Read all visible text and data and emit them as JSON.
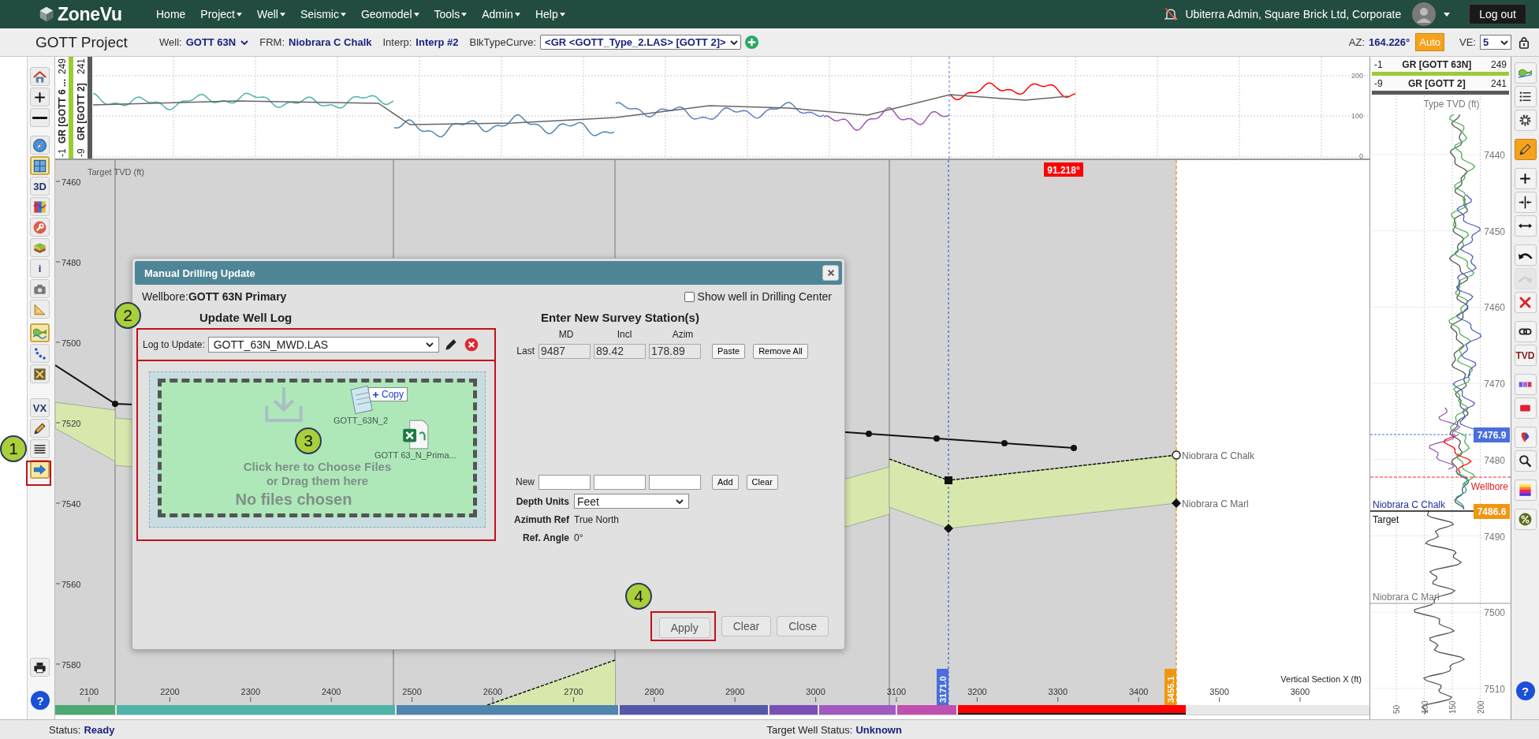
{
  "nav": {
    "logo": "ZoneVu",
    "menu": [
      {
        "label": "Home",
        "dropdown": false
      },
      {
        "label": "Project",
        "dropdown": true
      },
      {
        "label": "Well",
        "dropdown": true
      },
      {
        "label": "Seismic",
        "dropdown": true
      },
      {
        "label": "Geomodel",
        "dropdown": true
      },
      {
        "label": "Tools",
        "dropdown": true
      },
      {
        "label": "Admin",
        "dropdown": true
      },
      {
        "label": "Help",
        "dropdown": true
      }
    ],
    "user": "Ubiterra Admin, Square Brick Ltd, Corporate",
    "logout": "Log out"
  },
  "project_bar": {
    "title": "GOTT Project",
    "fields": [
      {
        "label": "Well:",
        "value": "GOTT 63N",
        "kind": "select"
      },
      {
        "label": "FRM:",
        "value": "Niobrara C Chalk",
        "kind": "text"
      },
      {
        "label": "Interp:",
        "value": "Interp #2",
        "kind": "text"
      },
      {
        "label": "BlkTypeCurve:",
        "value": "<GR <GOTT_Type_2.LAS> [GOTT 2]>",
        "kind": "select"
      }
    ],
    "az_label": "AZ:",
    "az_value": "164.226°",
    "auto": "Auto",
    "ve_label": "VE:",
    "ve_value": "5"
  },
  "left_tools": [
    {
      "items": [
        {
          "kind": "icon",
          "selected": false
        },
        {
          "kind": "icon",
          "selected": false
        },
        {
          "kind": "icon",
          "selected": false
        }
      ]
    },
    {
      "items": [
        {
          "kind": "icon",
          "selected": false
        },
        {
          "kind": "icon",
          "selected": true
        },
        {
          "kind": "text",
          "label": "3D",
          "selected": false
        },
        {
          "kind": "icon",
          "selected": false
        },
        {
          "kind": "icon",
          "selected": false
        },
        {
          "kind": "icon",
          "selected": false
        },
        {
          "kind": "text",
          "label": "i",
          "selected": false
        },
        {
          "kind": "icon",
          "selected": false
        },
        {
          "kind": "icon",
          "selected": false
        }
      ]
    },
    {
      "items": [
        {
          "kind": "icon",
          "selected": true
        },
        {
          "kind": "icon",
          "selected": false
        },
        {
          "kind": "icon",
          "selected": false
        }
      ]
    },
    {
      "items": [
        {
          "kind": "text",
          "label": "VX",
          "selected": false
        },
        {
          "kind": "icon",
          "selected": false
        },
        {
          "kind": "icon",
          "selected": false
        },
        {
          "kind": "icon",
          "selected": true
        }
      ]
    },
    {
      "items": [
        {
          "kind": "icon",
          "selected": false
        }
      ]
    },
    {
      "items": [
        {
          "kind": "help",
          "label": "?",
          "selected": false
        }
      ]
    }
  ],
  "top_log": {
    "tracks": [
      {
        "min": "-1",
        "name": "GR [GOTT 6 ...",
        "max": "249",
        "color": "#9acd32"
      },
      {
        "min": "-9",
        "name": "GR [GOTT 2]",
        "max": "241",
        "color": "#5a5a5a"
      }
    ],
    "y_ticks": [
      "200",
      "100",
      "0"
    ]
  },
  "section": {
    "y_axis_title": "Target TVD (ft)",
    "y_ticks": [
      "7460",
      "7480",
      "7500",
      "7520",
      "7540",
      "7560",
      "7580"
    ],
    "x_axis_title": "Vertical Section X (ft)",
    "x_ticks": [
      "2100",
      "2200",
      "2300",
      "2400",
      "2500",
      "2600",
      "2700",
      "2800",
      "2900",
      "3000",
      "3100",
      "3200",
      "3300",
      "3400",
      "3500",
      "3600"
    ],
    "dip_angle": "91.218°",
    "markers": [
      {
        "value": "3171.0",
        "color": "#4a6fdc"
      },
      {
        "value": "3455.1",
        "color": "#f0960f"
      }
    ],
    "formations": [
      "Niobrara C Chalk",
      "Niobrara C Marl"
    ],
    "zones": [
      {
        "color": "#4da872"
      },
      {
        "color": "#4fb3a9"
      },
      {
        "color": "#4f86b0"
      },
      {
        "color": "#5558a8"
      },
      {
        "color": "#7a50b5"
      },
      {
        "color": "#a05ac0"
      },
      {
        "color": "#c050b0"
      },
      {
        "color": "#ff0000"
      }
    ]
  },
  "dialog": {
    "title": "Manual Drilling Update",
    "wellbore": "Wellbore:**GOTT 63N Primary**",
    "show_in_center": {
      "label": "Show well in Drilling Center",
      "checked": false
    },
    "log_heading": "Update Well Log",
    "log_label": "Log to Update:",
    "log_value": "GOTT_63N_MWD.LAS",
    "drop_lines": [
      "Click here to Choose Files",
      "or Drag them here"
    ],
    "drop_status": "No files chosen",
    "drag_files": [
      {
        "kind": "text",
        "name": "GOTT_63N_2"
      },
      {
        "kind": "spreadsheet",
        "name": "GOTT 63_N_Prima..."
      }
    ],
    "copy_badge": "Copy",
    "survey_heading": "Enter New Survey Station(s)",
    "columns": [
      "MD",
      "Incl",
      "Azim"
    ],
    "last_label": "Last",
    "last_values": [
      "9487",
      "89.42",
      "178.89"
    ],
    "last_buttons": [
      "Paste",
      "Remove All"
    ],
    "new_label": "New",
    "new_buttons": [
      "Add",
      "Clear"
    ],
    "properties": [
      {
        "label": "Depth Units",
        "value": "Feet",
        "kind": "select"
      },
      {
        "label": "Azimuth Ref",
        "value": "True North",
        "kind": "text"
      },
      {
        "label": "Ref. Angle",
        "value": "0°",
        "kind": "text"
      }
    ],
    "footer_buttons": [
      "Apply",
      "Clear",
      "Close"
    ]
  },
  "type_log": {
    "tracks": [
      {
        "min": "-1",
        "name": "GR [GOTT 63N]",
        "max": "249",
        "color": "#9acd32"
      },
      {
        "min": "-9",
        "name": "GR [GOTT 2]",
        "max": "241",
        "color": "#5a5a5a"
      }
    ],
    "axis_title": "Type TVD (ft)",
    "y_ticks": [
      "7440",
      "7450",
      "7460",
      "7470",
      "7480",
      "7490",
      "7500",
      "7510"
    ],
    "x_ticks": [
      "50",
      "100",
      "150",
      "200"
    ],
    "markers": [
      {
        "label": "7476.9",
        "color": "#4a6fdc"
      },
      {
        "label": "7486.6",
        "color": "#f0960f"
      }
    ],
    "wellbore": "Wellbore",
    "formation_top": "Niobrara C Chalk",
    "target": "Target",
    "formation_base": "Niobrara C Marl"
  },
  "right_tools": [
    {
      "items": [
        {
          "kind": "icon",
          "selected": false,
          "disabled": false
        },
        {
          "kind": "icon",
          "selected": false,
          "disabled": false
        },
        {
          "kind": "icon",
          "selected": false,
          "disabled": false
        }
      ]
    },
    {
      "items": [
        {
          "kind": "icon",
          "selected": true,
          "disabled": false
        }
      ]
    },
    {
      "items": [
        {
          "kind": "icon",
          "selected": false,
          "disabled": false
        },
        {
          "kind": "icon",
          "selected": false,
          "disabled": false
        },
        {
          "kind": "icon",
          "selected": false,
          "disabled": false
        }
      ]
    },
    {
      "items": [
        {
          "kind": "icon",
          "selected": false,
          "disabled": false
        },
        {
          "kind": "icon",
          "selected": false,
          "disabled": true
        },
        {
          "kind": "icon",
          "selected": false,
          "disabled": false
        }
      ]
    },
    {
      "items": [
        {
          "kind": "icon",
          "selected": false,
          "disabled": false
        },
        {
          "kind": "text",
          "label": "TVD",
          "selected": false,
          "disabled": false
        }
      ]
    },
    {
      "items": [
        {
          "kind": "icon",
          "selected": false,
          "disabled": false
        },
        {
          "kind": "icon",
          "selected": false,
          "disabled": false
        }
      ]
    },
    {
      "items": [
        {
          "kind": "icon",
          "selected": false,
          "disabled": false
        },
        {
          "kind": "icon",
          "selected": false,
          "disabled": false
        }
      ]
    },
    {
      "items": [
        {
          "kind": "icon",
          "selected": false,
          "disabled": false
        }
      ]
    },
    {
      "items": [
        {
          "kind": "icon",
          "selected": false,
          "disabled": false
        }
      ]
    },
    {
      "items": [
        {
          "kind": "help",
          "label": "?",
          "selected": false,
          "disabled": false
        }
      ]
    }
  ],
  "status": {
    "label": "Status:",
    "value": "Ready",
    "target_label": "Target Well Status:",
    "target_value": "Unknown"
  },
  "callouts": [
    "1",
    "2",
    "3",
    "4"
  ]
}
